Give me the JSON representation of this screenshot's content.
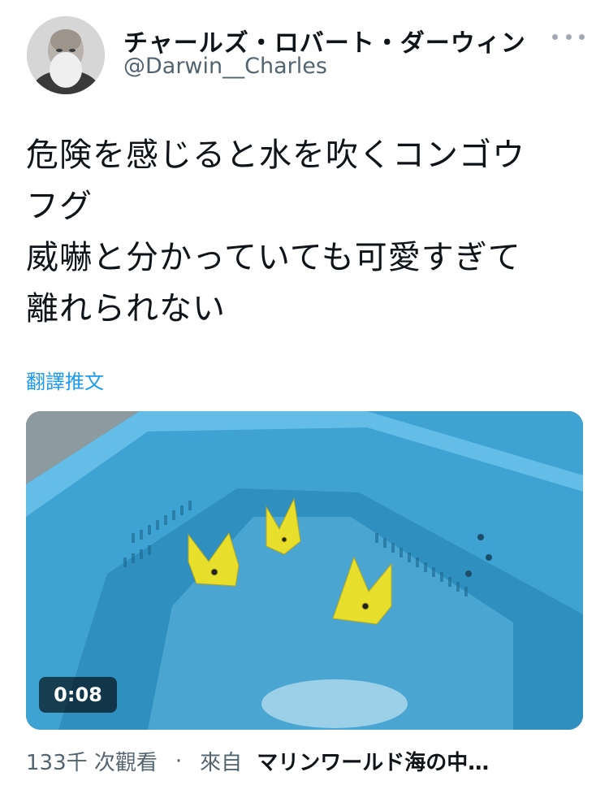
{
  "author": {
    "display_name": "チャールズ・ロバート・ダーウィン",
    "handle": "@Darwin__Charles"
  },
  "tweet": {
    "lines": [
      "危険を感じると水を吹くコンゴウ",
      "フグ",
      "威嚇と分かっていても可愛すぎて",
      "離れられない"
    ],
    "translate_label": "翻譯推文"
  },
  "media": {
    "timecode": "0:08"
  },
  "footer": {
    "views": "133千 次觀看",
    "separator": "·",
    "from_label": "來自",
    "source": "マリンワールド海の中…"
  },
  "colors": {
    "link": "#1d9bf0",
    "muted": "#536471",
    "text": "#0f1419"
  },
  "icons": [
    "more-icon"
  ]
}
